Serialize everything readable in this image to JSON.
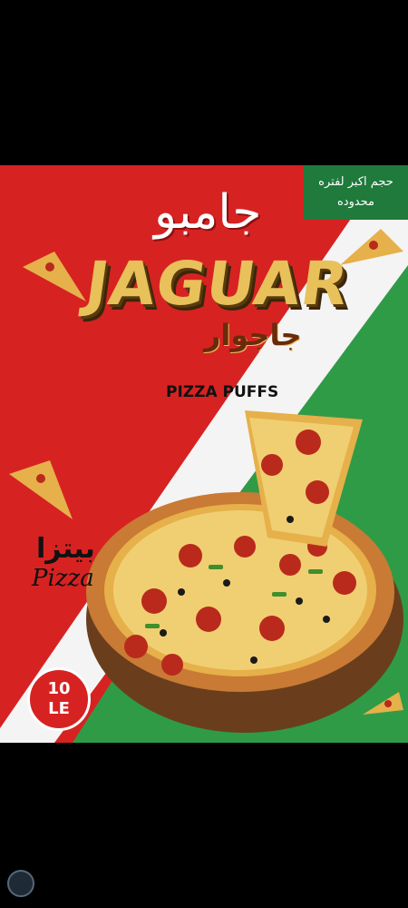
{
  "poster": {
    "promo_line1": "حجم اكبر لفتره",
    "promo_line2": "محدوده",
    "jumbo_ar": "جامبو",
    "brand_en": "JAGUAR",
    "brand_ar": "جاجوار",
    "product": "PIZZA PUFFS",
    "pizza_ar": "بيتزا",
    "pizza_en": "Pizza",
    "price_value": "10",
    "price_unit": "LE"
  },
  "colors": {
    "red": "#d72222",
    "green": "#2f9b47",
    "white": "#f4f4f4",
    "logo_gold": "#e8c15a"
  },
  "images": {
    "main": "pizza-photo",
    "slices": "pizza-slice-icon"
  }
}
